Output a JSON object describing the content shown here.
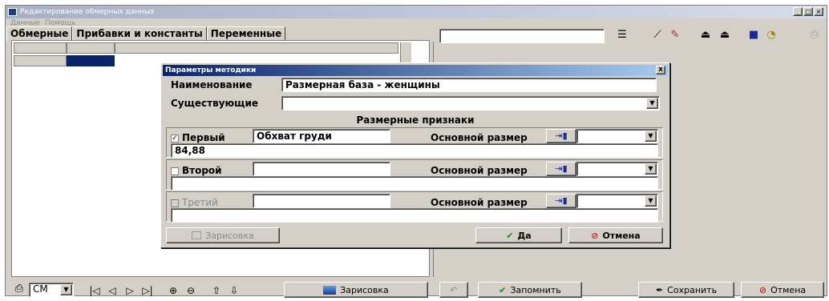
{
  "window": {
    "title": "Редактирование обмерных данных"
  },
  "menu": [
    {
      "label": "Данные"
    },
    {
      "label": "Помощь"
    }
  ],
  "tabs": [
    {
      "label": "Обмерные"
    },
    {
      "label": "Прибавки и константы"
    },
    {
      "label": "Переменные"
    }
  ],
  "toolbar": {
    "search_value": ""
  },
  "bottom": {
    "unit": "СМ",
    "sketch_label": "Зарисовка",
    "remember_label": "Запомнить",
    "save_label": "Сохранить",
    "cancel_label": "Отмена"
  },
  "dialog": {
    "title": "Параметры методики",
    "close": "x",
    "name_label": "Наименование",
    "name_value": "Размерная база - женщины",
    "existing_label": "Существующие",
    "existing_value": "",
    "section_title": "Размерные признаки",
    "rows": [
      {
        "label": "Первый",
        "checked": true,
        "field": "Обхват груди",
        "main_label": "Основной размер",
        "main_value": "",
        "values": "84,88",
        "enabled": true
      },
      {
        "label": "Второй",
        "checked": false,
        "field": "",
        "main_label": "Основной размер",
        "main_value": "",
        "values": "",
        "enabled": true
      },
      {
        "label": "Третий",
        "checked": false,
        "field": "",
        "main_label": "Основной размер",
        "main_value": "",
        "values": "",
        "enabled": false
      }
    ],
    "sketch_label": "Зарисовка",
    "ok_label": "Да",
    "cancel_label": "Отмена"
  },
  "colors": {
    "accent": "#0a246a",
    "ok_check": "#1a8a1a",
    "cancel_red": "#d02020",
    "face": "#d4d0c8"
  }
}
